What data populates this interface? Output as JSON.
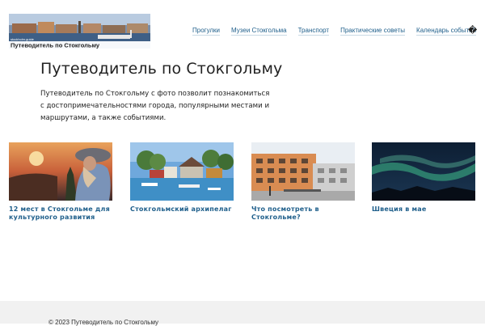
{
  "header": {
    "logo_caption": "Путеводитель по Стокгольму",
    "logo_small_text": "stockholm.guide",
    "nav": [
      {
        "label": "Прогулки"
      },
      {
        "label": "Музеи Стокгольма"
      },
      {
        "label": "Транспорт"
      },
      {
        "label": "Практические советы"
      },
      {
        "label": "Календарь событий"
      }
    ],
    "search_glyph": "�"
  },
  "intro": {
    "title": "Путеводитель по Стокгольму",
    "text": "Путеводитель по Стокгольму с фото позволит познакомиться с достопримечательностями города, популярными местами и маршрутами, а также событиями."
  },
  "cards": [
    {
      "caption": "12 мест в Стокгольме для культурного развития"
    },
    {
      "caption": "Стокгольмский архипелаг"
    },
    {
      "caption": "Что посмотреть в Стокгольме?"
    },
    {
      "caption": "Швеция в мае"
    }
  ],
  "footer": {
    "copyright": "© 2023 Путеводитель по Стокгольму"
  }
}
